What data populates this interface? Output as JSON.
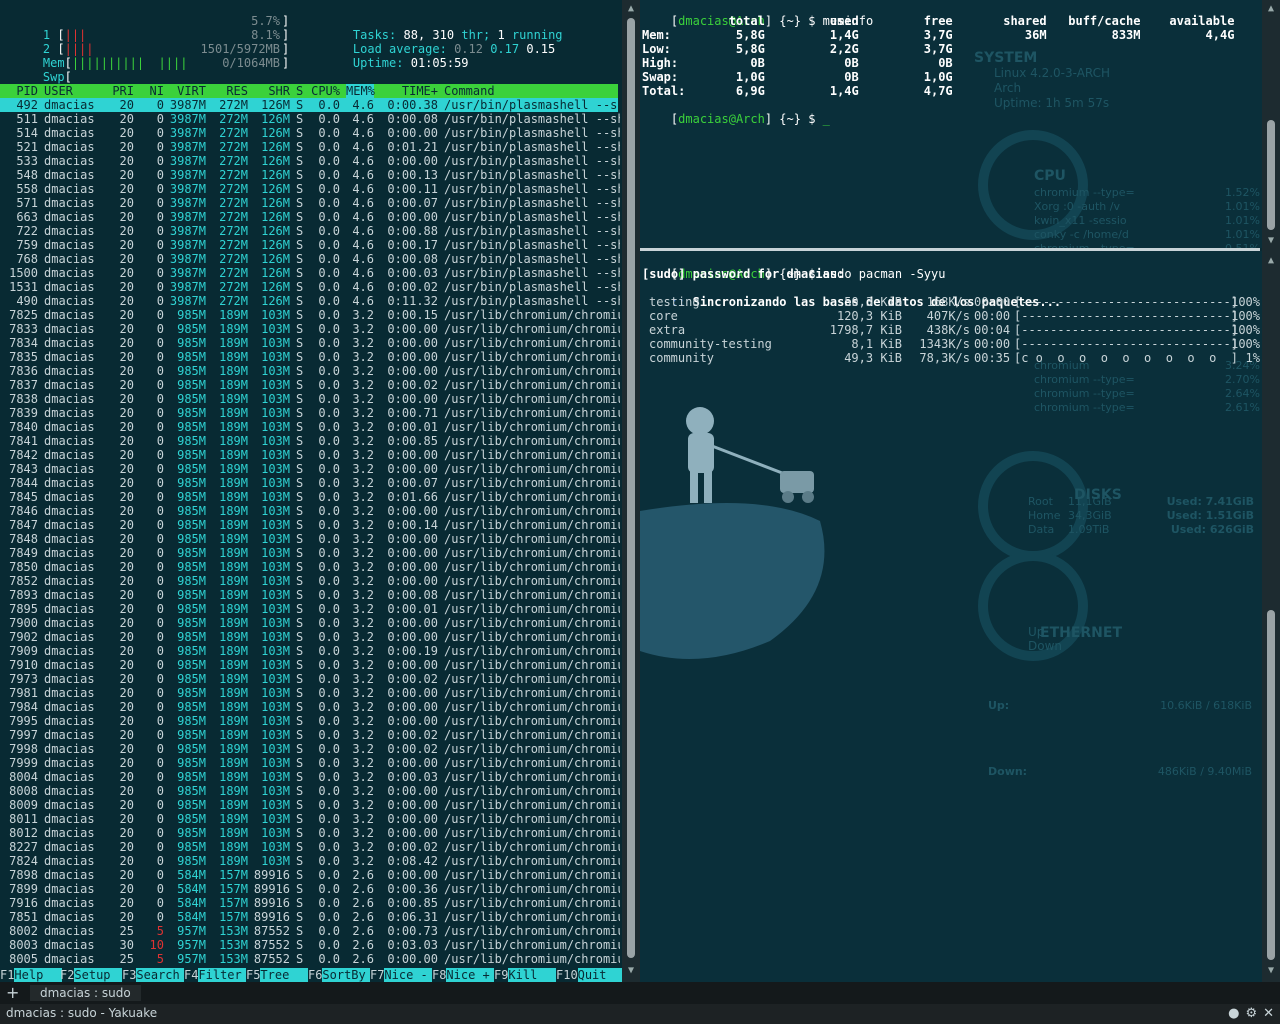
{
  "htop": {
    "cpu1": {
      "num": "1",
      "bars": "|||",
      "pct": "5.7%"
    },
    "cpu2": {
      "num": "2",
      "bars": "||||",
      "pct": "8.1%"
    },
    "mem": {
      "label": "Mem",
      "bars": "||||||||||  ||||",
      "value": "1501/5972MB"
    },
    "swp": {
      "label": "Swp",
      "value": "0/1064MB"
    },
    "tasks_label": "Tasks:",
    "tasks": "88,",
    "thr": "310",
    "thr_label": "thr;",
    "running": "1",
    "running_label": "running",
    "load_label": "Load average:",
    "load1": "0.12",
    "load5": "0.17",
    "load15": "0.15",
    "uptime_label": "Uptime:",
    "uptime": "01:05:59",
    "columns": [
      "PID",
      "USER",
      "PRI",
      "NI",
      "VIRT",
      "RES",
      "SHR",
      "S",
      "CPU%",
      "MEM%",
      "TIME+",
      "Command"
    ],
    "rows": [
      [
        "492",
        "dmacias",
        "20",
        "0",
        "3987M",
        "272M",
        "126M",
        "S",
        "0.0",
        "4.6",
        "0:00.38",
        "/usr/bin/plasmashell --sh"
      ],
      [
        "511",
        "dmacias",
        "20",
        "0",
        "3987M",
        "272M",
        "126M",
        "S",
        "0.0",
        "4.6",
        "0:00.08",
        "/usr/bin/plasmashell --sh"
      ],
      [
        "514",
        "dmacias",
        "20",
        "0",
        "3987M",
        "272M",
        "126M",
        "S",
        "0.0",
        "4.6",
        "0:00.00",
        "/usr/bin/plasmashell --sh"
      ],
      [
        "521",
        "dmacias",
        "20",
        "0",
        "3987M",
        "272M",
        "126M",
        "S",
        "0.0",
        "4.6",
        "0:01.21",
        "/usr/bin/plasmashell --sh"
      ],
      [
        "533",
        "dmacias",
        "20",
        "0",
        "3987M",
        "272M",
        "126M",
        "S",
        "0.0",
        "4.6",
        "0:00.00",
        "/usr/bin/plasmashell --sh"
      ],
      [
        "548",
        "dmacias",
        "20",
        "0",
        "3987M",
        "272M",
        "126M",
        "S",
        "0.0",
        "4.6",
        "0:00.13",
        "/usr/bin/plasmashell --sh"
      ],
      [
        "558",
        "dmacias",
        "20",
        "0",
        "3987M",
        "272M",
        "126M",
        "S",
        "0.0",
        "4.6",
        "0:00.11",
        "/usr/bin/plasmashell --sh"
      ],
      [
        "571",
        "dmacias",
        "20",
        "0",
        "3987M",
        "272M",
        "126M",
        "S",
        "0.0",
        "4.6",
        "0:00.07",
        "/usr/bin/plasmashell --sh"
      ],
      [
        "663",
        "dmacias",
        "20",
        "0",
        "3987M",
        "272M",
        "126M",
        "S",
        "0.0",
        "4.6",
        "0:00.00",
        "/usr/bin/plasmashell --sh"
      ],
      [
        "722",
        "dmacias",
        "20",
        "0",
        "3987M",
        "272M",
        "126M",
        "S",
        "0.0",
        "4.6",
        "0:00.88",
        "/usr/bin/plasmashell --sh"
      ],
      [
        "759",
        "dmacias",
        "20",
        "0",
        "3987M",
        "272M",
        "126M",
        "S",
        "0.0",
        "4.6",
        "0:00.17",
        "/usr/bin/plasmashell --sh"
      ],
      [
        "768",
        "dmacias",
        "20",
        "0",
        "3987M",
        "272M",
        "126M",
        "S",
        "0.0",
        "4.6",
        "0:00.08",
        "/usr/bin/plasmashell --sh"
      ],
      [
        "1500",
        "dmacias",
        "20",
        "0",
        "3987M",
        "272M",
        "126M",
        "S",
        "0.0",
        "4.6",
        "0:00.03",
        "/usr/bin/plasmashell --sh"
      ],
      [
        "1531",
        "dmacias",
        "20",
        "0",
        "3987M",
        "272M",
        "126M",
        "S",
        "0.0",
        "4.6",
        "0:00.02",
        "/usr/bin/plasmashell --sh"
      ],
      [
        "490",
        "dmacias",
        "20",
        "0",
        "3987M",
        "272M",
        "126M",
        "S",
        "0.0",
        "4.6",
        "0:11.32",
        "/usr/bin/plasmashell --sh"
      ],
      [
        "7825",
        "dmacias",
        "20",
        "0",
        "985M",
        "189M",
        "103M",
        "S",
        "0.0",
        "3.2",
        "0:00.15",
        "/usr/lib/chromium/chromiu"
      ],
      [
        "7833",
        "dmacias",
        "20",
        "0",
        "985M",
        "189M",
        "103M",
        "S",
        "0.0",
        "3.2",
        "0:00.00",
        "/usr/lib/chromium/chromiu"
      ],
      [
        "7834",
        "dmacias",
        "20",
        "0",
        "985M",
        "189M",
        "103M",
        "S",
        "0.0",
        "3.2",
        "0:00.00",
        "/usr/lib/chromium/chromiu"
      ],
      [
        "7835",
        "dmacias",
        "20",
        "0",
        "985M",
        "189M",
        "103M",
        "S",
        "0.0",
        "3.2",
        "0:00.00",
        "/usr/lib/chromium/chromiu"
      ],
      [
        "7836",
        "dmacias",
        "20",
        "0",
        "985M",
        "189M",
        "103M",
        "S",
        "0.0",
        "3.2",
        "0:00.00",
        "/usr/lib/chromium/chromiu"
      ],
      [
        "7837",
        "dmacias",
        "20",
        "0",
        "985M",
        "189M",
        "103M",
        "S",
        "0.0",
        "3.2",
        "0:00.02",
        "/usr/lib/chromium/chromiu"
      ],
      [
        "7838",
        "dmacias",
        "20",
        "0",
        "985M",
        "189M",
        "103M",
        "S",
        "0.0",
        "3.2",
        "0:00.00",
        "/usr/lib/chromium/chromiu"
      ],
      [
        "7839",
        "dmacias",
        "20",
        "0",
        "985M",
        "189M",
        "103M",
        "S",
        "0.0",
        "3.2",
        "0:00.71",
        "/usr/lib/chromium/chromiu"
      ],
      [
        "7840",
        "dmacias",
        "20",
        "0",
        "985M",
        "189M",
        "103M",
        "S",
        "0.0",
        "3.2",
        "0:00.01",
        "/usr/lib/chromium/chromiu"
      ],
      [
        "7841",
        "dmacias",
        "20",
        "0",
        "985M",
        "189M",
        "103M",
        "S",
        "0.0",
        "3.2",
        "0:00.85",
        "/usr/lib/chromium/chromiu"
      ],
      [
        "7842",
        "dmacias",
        "20",
        "0",
        "985M",
        "189M",
        "103M",
        "S",
        "0.0",
        "3.2",
        "0:00.00",
        "/usr/lib/chromium/chromiu"
      ],
      [
        "7843",
        "dmacias",
        "20",
        "0",
        "985M",
        "189M",
        "103M",
        "S",
        "0.0",
        "3.2",
        "0:00.00",
        "/usr/lib/chromium/chromiu"
      ],
      [
        "7844",
        "dmacias",
        "20",
        "0",
        "985M",
        "189M",
        "103M",
        "S",
        "0.0",
        "3.2",
        "0:00.07",
        "/usr/lib/chromium/chromiu"
      ],
      [
        "7845",
        "dmacias",
        "20",
        "0",
        "985M",
        "189M",
        "103M",
        "S",
        "0.0",
        "3.2",
        "0:01.66",
        "/usr/lib/chromium/chromiu"
      ],
      [
        "7846",
        "dmacias",
        "20",
        "0",
        "985M",
        "189M",
        "103M",
        "S",
        "0.0",
        "3.2",
        "0:00.00",
        "/usr/lib/chromium/chromiu"
      ],
      [
        "7847",
        "dmacias",
        "20",
        "0",
        "985M",
        "189M",
        "103M",
        "S",
        "0.0",
        "3.2",
        "0:00.14",
        "/usr/lib/chromium/chromiu"
      ],
      [
        "7848",
        "dmacias",
        "20",
        "0",
        "985M",
        "189M",
        "103M",
        "S",
        "0.0",
        "3.2",
        "0:00.00",
        "/usr/lib/chromium/chromiu"
      ],
      [
        "7849",
        "dmacias",
        "20",
        "0",
        "985M",
        "189M",
        "103M",
        "S",
        "0.0",
        "3.2",
        "0:00.00",
        "/usr/lib/chromium/chromiu"
      ],
      [
        "7850",
        "dmacias",
        "20",
        "0",
        "985M",
        "189M",
        "103M",
        "S",
        "0.0",
        "3.2",
        "0:00.00",
        "/usr/lib/chromium/chromiu"
      ],
      [
        "7852",
        "dmacias",
        "20",
        "0",
        "985M",
        "189M",
        "103M",
        "S",
        "0.0",
        "3.2",
        "0:00.00",
        "/usr/lib/chromium/chromiu"
      ],
      [
        "7893",
        "dmacias",
        "20",
        "0",
        "985M",
        "189M",
        "103M",
        "S",
        "0.0",
        "3.2",
        "0:00.08",
        "/usr/lib/chromium/chromiu"
      ],
      [
        "7895",
        "dmacias",
        "20",
        "0",
        "985M",
        "189M",
        "103M",
        "S",
        "0.0",
        "3.2",
        "0:00.01",
        "/usr/lib/chromium/chromiu"
      ],
      [
        "7900",
        "dmacias",
        "20",
        "0",
        "985M",
        "189M",
        "103M",
        "S",
        "0.0",
        "3.2",
        "0:00.00",
        "/usr/lib/chromium/chromiu"
      ],
      [
        "7902",
        "dmacias",
        "20",
        "0",
        "985M",
        "189M",
        "103M",
        "S",
        "0.0",
        "3.2",
        "0:00.00",
        "/usr/lib/chromium/chromiu"
      ],
      [
        "7909",
        "dmacias",
        "20",
        "0",
        "985M",
        "189M",
        "103M",
        "S",
        "0.0",
        "3.2",
        "0:00.19",
        "/usr/lib/chromium/chromiu"
      ],
      [
        "7910",
        "dmacias",
        "20",
        "0",
        "985M",
        "189M",
        "103M",
        "S",
        "0.0",
        "3.2",
        "0:00.00",
        "/usr/lib/chromium/chromiu"
      ],
      [
        "7973",
        "dmacias",
        "20",
        "0",
        "985M",
        "189M",
        "103M",
        "S",
        "0.0",
        "3.2",
        "0:00.02",
        "/usr/lib/chromium/chromiu"
      ],
      [
        "7981",
        "dmacias",
        "20",
        "0",
        "985M",
        "189M",
        "103M",
        "S",
        "0.0",
        "3.2",
        "0:00.00",
        "/usr/lib/chromium/chromiu"
      ],
      [
        "7984",
        "dmacias",
        "20",
        "0",
        "985M",
        "189M",
        "103M",
        "S",
        "0.0",
        "3.2",
        "0:00.00",
        "/usr/lib/chromium/chromiu"
      ],
      [
        "7995",
        "dmacias",
        "20",
        "0",
        "985M",
        "189M",
        "103M",
        "S",
        "0.0",
        "3.2",
        "0:00.00",
        "/usr/lib/chromium/chromiu"
      ],
      [
        "7997",
        "dmacias",
        "20",
        "0",
        "985M",
        "189M",
        "103M",
        "S",
        "0.0",
        "3.2",
        "0:00.02",
        "/usr/lib/chromium/chromiu"
      ],
      [
        "7998",
        "dmacias",
        "20",
        "0",
        "985M",
        "189M",
        "103M",
        "S",
        "0.0",
        "3.2",
        "0:00.02",
        "/usr/lib/chromium/chromiu"
      ],
      [
        "7999",
        "dmacias",
        "20",
        "0",
        "985M",
        "189M",
        "103M",
        "S",
        "0.0",
        "3.2",
        "0:00.00",
        "/usr/lib/chromium/chromiu"
      ],
      [
        "8004",
        "dmacias",
        "20",
        "0",
        "985M",
        "189M",
        "103M",
        "S",
        "0.0",
        "3.2",
        "0:00.03",
        "/usr/lib/chromium/chromiu"
      ],
      [
        "8008",
        "dmacias",
        "20",
        "0",
        "985M",
        "189M",
        "103M",
        "S",
        "0.0",
        "3.2",
        "0:00.00",
        "/usr/lib/chromium/chromiu"
      ],
      [
        "8009",
        "dmacias",
        "20",
        "0",
        "985M",
        "189M",
        "103M",
        "S",
        "0.0",
        "3.2",
        "0:00.00",
        "/usr/lib/chromium/chromiu"
      ],
      [
        "8011",
        "dmacias",
        "20",
        "0",
        "985M",
        "189M",
        "103M",
        "S",
        "0.0",
        "3.2",
        "0:00.00",
        "/usr/lib/chromium/chromiu"
      ],
      [
        "8012",
        "dmacias",
        "20",
        "0",
        "985M",
        "189M",
        "103M",
        "S",
        "0.0",
        "3.2",
        "0:00.00",
        "/usr/lib/chromium/chromiu"
      ],
      [
        "8227",
        "dmacias",
        "20",
        "0",
        "985M",
        "189M",
        "103M",
        "S",
        "0.0",
        "3.2",
        "0:00.02",
        "/usr/lib/chromium/chromiu"
      ],
      [
        "7824",
        "dmacias",
        "20",
        "0",
        "985M",
        "189M",
        "103M",
        "S",
        "0.0",
        "3.2",
        "0:08.42",
        "/usr/lib/chromium/chromiu"
      ],
      [
        "7898",
        "dmacias",
        "20",
        "0",
        "584M",
        "157M",
        "89916",
        "S",
        "0.0",
        "2.6",
        "0:00.00",
        "/usr/lib/chromium/chromiu"
      ],
      [
        "7899",
        "dmacias",
        "20",
        "0",
        "584M",
        "157M",
        "89916",
        "S",
        "0.0",
        "2.6",
        "0:00.36",
        "/usr/lib/chromium/chromiu"
      ],
      [
        "7916",
        "dmacias",
        "20",
        "0",
        "584M",
        "157M",
        "89916",
        "S",
        "0.0",
        "2.6",
        "0:00.85",
        "/usr/lib/chromium/chromiu"
      ],
      [
        "7851",
        "dmacias",
        "20",
        "0",
        "584M",
        "157M",
        "89916",
        "S",
        "0.0",
        "2.6",
        "0:06.31",
        "/usr/lib/chromium/chromiu"
      ],
      [
        "8002",
        "dmacias",
        "25",
        "5",
        "957M",
        "153M",
        "87552",
        "S",
        "0.0",
        "2.6",
        "0:00.73",
        "/usr/lib/chromium/chromiu"
      ],
      [
        "8003",
        "dmacias",
        "30",
        "10",
        "957M",
        "153M",
        "87552",
        "S",
        "0.0",
        "2.6",
        "0:03.03",
        "/usr/lib/chromium/chromiu"
      ],
      [
        "8005",
        "dmacias",
        "25",
        "5",
        "957M",
        "153M",
        "87552",
        "S",
        "0.0",
        "2.6",
        "0:00.00",
        "/usr/lib/chromium/chromiu"
      ]
    ],
    "fkeys": [
      {
        "k": "F1",
        "v": "Help"
      },
      {
        "k": "F2",
        "v": "Setup"
      },
      {
        "k": "F3",
        "v": "Search"
      },
      {
        "k": "F4",
        "v": "Filter"
      },
      {
        "k": "F5",
        "v": "Tree"
      },
      {
        "k": "F6",
        "v": "SortBy"
      },
      {
        "k": "F7",
        "v": "Nice -"
      },
      {
        "k": "F8",
        "v": "Nice +"
      },
      {
        "k": "F9",
        "v": "Kill"
      },
      {
        "k": "F10",
        "v": "Quit"
      }
    ]
  },
  "meminfo": {
    "prompt_open": "[",
    "prompt_user": "dmacias@Arch",
    "prompt_path": "] {~} $",
    "command": "meminfo",
    "header": "            total         used         free       shared   buff/cache    available",
    "lines": [
      "Mem:         5,8G         1,4G         3,7G          36M         833M         4,4G",
      "Low:         5,8G         2,2G         3,7G",
      "High:          0B           0B           0B",
      "Swap:        1,0G           0B         1,0G",
      "Total:       6,9G         1,4G         4,7G"
    ],
    "cursor": "_"
  },
  "pacman": {
    "command": "sudo pacman -Syyu",
    "sudo_line": "[sudo] password for dmacias:",
    "sync_prefix": "::",
    "sync_line": "Sincronizando las bases de datos de los paquetes...",
    "repos": [
      {
        "name": "testing",
        "size": "50,3 KiB",
        "speed": "168K/s",
        "time": "00:00",
        "bar": "[-----------------------------]",
        "pct": "100%"
      },
      {
        "name": "core",
        "size": "120,3 KiB",
        "speed": "407K/s",
        "time": "00:00",
        "bar": "[-----------------------------]",
        "pct": "100%"
      },
      {
        "name": "extra",
        "size": "1798,7 KiB",
        "speed": "438K/s",
        "time": "00:04",
        "bar": "[-----------------------------]",
        "pct": "100%"
      },
      {
        "name": "community-testing",
        "size": "8,1 KiB",
        "speed": "1343K/s",
        "time": "00:00",
        "bar": "[-----------------------------]",
        "pct": "100%"
      },
      {
        "name": "community",
        "size": "49,3 KiB",
        "speed": "78,3K/s",
        "time": "00:35",
        "bar": "[c o  o  o  o  o  o  o  o  o  ]",
        "pct": "1%"
      }
    ]
  },
  "conky": {
    "system": "SYSTEM",
    "kernel": "Linux 4.2.0-3-ARCH",
    "distro": "Arch",
    "uptime": "Uptime: 1h 5m 57s",
    "cpu": "CPU",
    "cpu_procs": [
      "chromium --type=",
      "Xorg :0 -auth /v",
      "kwin_x11 -sessio",
      "conky -c /home/d",
      "chromium --type="
    ],
    "cpu_pcts": [
      "1.52%",
      "1.01%",
      "1.01%",
      "1.01%",
      "0.51%"
    ],
    "mem_procs": [
      "chromium",
      "chromium --type=",
      "chromium --type=",
      "chromium --type="
    ],
    "mem_pcts": [
      "3.24%",
      "2.70%",
      "2.64%",
      "2.61%"
    ],
    "disks": "DISKS",
    "disk_labels": [
      "Root",
      "Home",
      "Data"
    ],
    "disk_sizes": [
      "11,1GiB",
      "34,3GiB",
      "1.09TiB"
    ],
    "disk_used": [
      "Used: 7.41GiB",
      "Used: 1.51GiB",
      "Used: 626GiB"
    ],
    "ethernet": "ETHERNET",
    "eth_up": "Up",
    "eth_down": "Down",
    "up_label": "Up:",
    "up_val": "10.6KiB / 618KiB",
    "down_label": "Down:",
    "down_val": "486KiB / 9.40MiB"
  },
  "tabbar": {
    "plus": "+",
    "tab_label": "dmacias : sudo"
  },
  "statusbar": {
    "title": "dmacias : sudo - Yakuake"
  }
}
